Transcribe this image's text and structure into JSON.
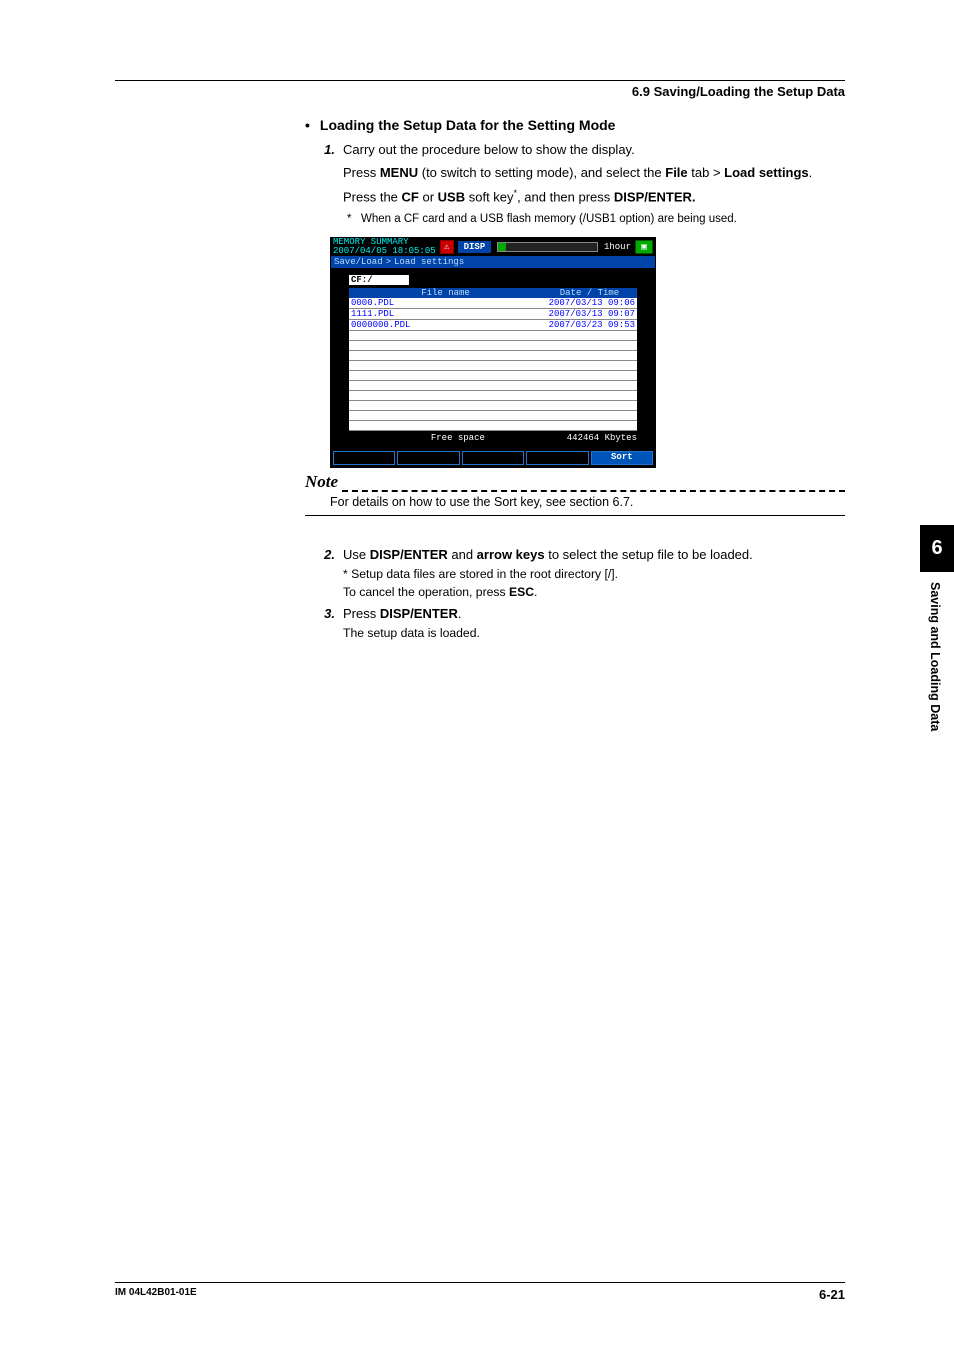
{
  "header": {
    "section": "6.9  Saving/Loading the Setup Data"
  },
  "heading1": {
    "bullet": "•",
    "text": "Loading the Setup Data for the Setting Mode"
  },
  "step1": {
    "num": "1.",
    "line1": "Carry out the procedure below to show the display.",
    "line2a": "Press ",
    "line2b": "MENU",
    "line2c": " (to switch to setting mode), and select the ",
    "line2d": "File",
    "line2e": " tab > ",
    "line2f": "Load settings",
    "line2g": ".",
    "line3a": "Press the ",
    "line3b": "CF",
    "line3c": " or ",
    "line3d": "USB",
    "line3e": " soft key",
    "line3sup": "*",
    "line3f": ", and then press ",
    "line3g": "DISP/ENTER."
  },
  "fn1": {
    "star": "*",
    "text": "When a CF card and a USB flash memory (/USB1 option) are being used."
  },
  "device": {
    "title1": "MEMORY SUMMARY",
    "title2": "2007/04/05 18:05:05",
    "disp": "DISP",
    "hour": "1hour",
    "crumb1": "Save/Load",
    "crumbSep": ">",
    "crumb2": "Load settings",
    "path": "CF:/",
    "col1": "File name",
    "col2": "Date / Time",
    "rows": [
      {
        "name": "0000.PDL",
        "dt": "2007/03/13 09:06"
      },
      {
        "name": "1111.PDL",
        "dt": "2007/03/13 09:07"
      },
      {
        "name": "0000000.PDL",
        "dt": "2007/03/23 09:53"
      }
    ],
    "freeLabel": "Free space",
    "freeVal": "442464 Kbytes",
    "sort": "Sort"
  },
  "note": {
    "label": "Note",
    "body": "For details on how to use the Sort key, see section 6.7."
  },
  "step2": {
    "num": "2.",
    "a": "Use ",
    "b": "DISP/ENTER",
    "c": " and ",
    "d": "arrow keys",
    "e": " to select the setup file to be loaded.",
    "sub1star": "*",
    "sub1": " Setup data files are stored in the root directory [/].",
    "sub2a": "To cancel the operation, press ",
    "sub2b": "ESC",
    "sub2c": "."
  },
  "step3": {
    "num": "3.",
    "a": "Press ",
    "b": "DISP/ENTER",
    "c": ".",
    "sub": "The setup data is loaded."
  },
  "sidebar": {
    "chapter": "6",
    "title": "Saving and Loading Data"
  },
  "footer": {
    "left": "IM 04L42B01-01E",
    "right": "6-21"
  }
}
